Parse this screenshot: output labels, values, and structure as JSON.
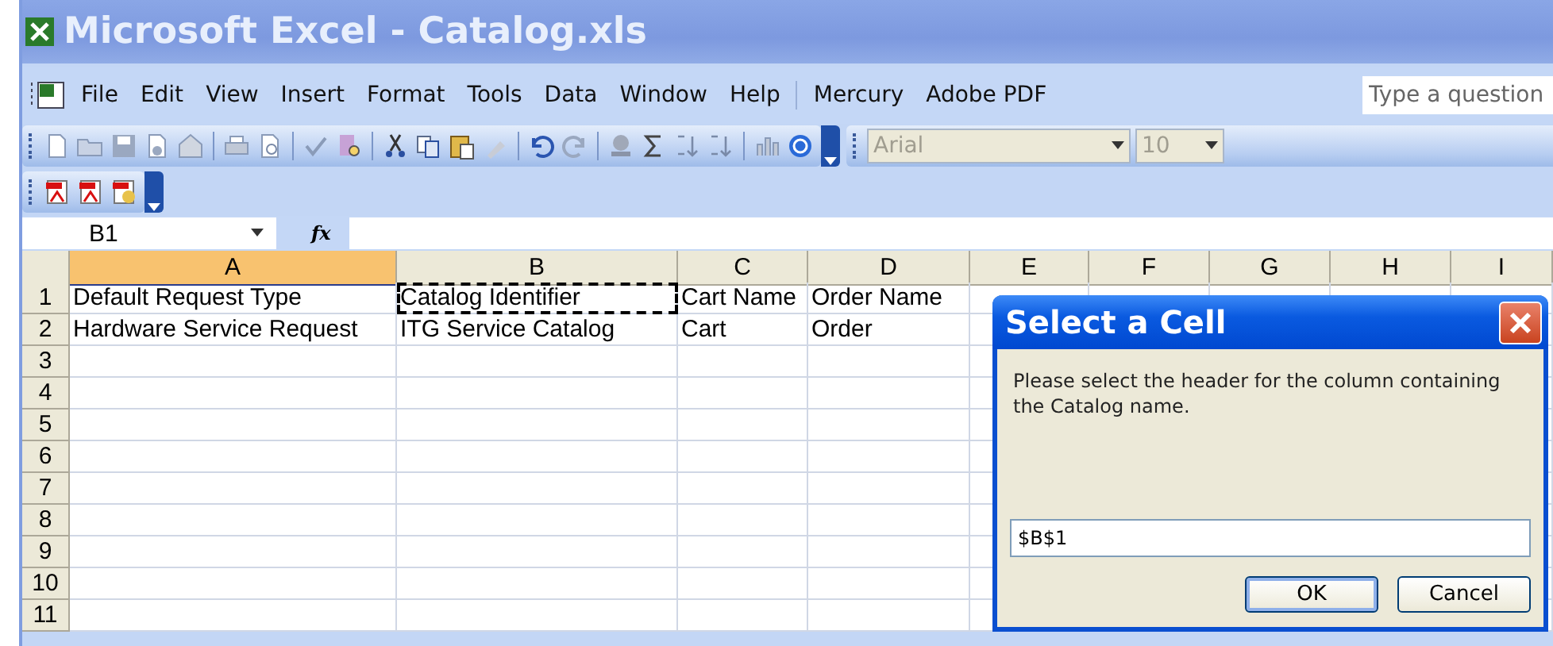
{
  "window": {
    "title": "Microsoft Excel - Catalog.xls"
  },
  "menu": [
    "File",
    "Edit",
    "View",
    "Insert",
    "Format",
    "Tools",
    "Data",
    "Window",
    "Help",
    "Mercury",
    "Adobe PDF"
  ],
  "help_search": {
    "placeholder": "Type a question"
  },
  "formatting": {
    "font": {
      "value": "Arial",
      "disabled": true
    },
    "size": {
      "value": "10",
      "disabled": true
    }
  },
  "formula_bar": {
    "name_box": "B1",
    "function_label": "fx"
  },
  "sheet": {
    "columns": [
      {
        "label": "A",
        "selected": true
      },
      {
        "label": "B",
        "selected": false
      },
      {
        "label": "C",
        "selected": false
      },
      {
        "label": "D",
        "selected": false
      },
      {
        "label": "E",
        "selected": false
      },
      {
        "label": "F",
        "selected": false
      },
      {
        "label": "G",
        "selected": false
      },
      {
        "label": "H",
        "selected": false
      },
      {
        "label": "I",
        "selected": false
      }
    ],
    "rows": [
      {
        "label": "1",
        "cells": [
          {
            "text": "Default Request Type",
            "marquee": false
          },
          {
            "text": "Catalog Identifier",
            "marquee": true
          },
          {
            "text": "Cart Name",
            "marquee": false
          },
          {
            "text": "Order Name",
            "marquee": false
          }
        ]
      },
      {
        "label": "2",
        "cells": [
          {
            "text": "Hardware Service Request",
            "marquee": false
          },
          {
            "text": "ITG Service Catalog",
            "marquee": false
          },
          {
            "text": "Cart",
            "marquee": false
          },
          {
            "text": "Order",
            "marquee": false
          }
        ]
      },
      {
        "label": "3"
      },
      {
        "label": "4"
      },
      {
        "label": "5"
      },
      {
        "label": "6"
      },
      {
        "label": "7"
      },
      {
        "label": "8"
      },
      {
        "label": "9"
      },
      {
        "label": "10"
      },
      {
        "label": "11"
      }
    ]
  },
  "dialog": {
    "title": "Select a Cell",
    "message": "Please select the header for the column containing the Catalog name.",
    "value": "$B$1",
    "buttons": [
      {
        "label": "OK",
        "default": true
      },
      {
        "label": "Cancel",
        "default": false
      }
    ]
  }
}
